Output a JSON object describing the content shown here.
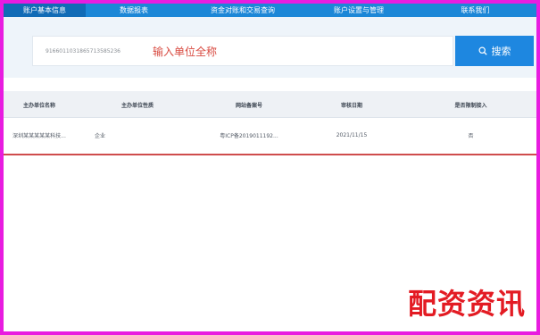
{
  "nav": {
    "tabs": [
      {
        "label": "账户基本信息",
        "active": true
      },
      {
        "label": "数据报表",
        "active": false
      },
      {
        "label": "资金对账和交易查询",
        "active": false
      },
      {
        "label": "账户设置与管理",
        "active": false
      },
      {
        "label": "联系我们",
        "active": false
      }
    ]
  },
  "search": {
    "value": "9166011031865713585236",
    "placeholder": "输入单位全称",
    "button_label": "搜索"
  },
  "table": {
    "columns": [
      "主办单位名称",
      "主办单位性质",
      "网站备案号",
      "审核日期",
      "是否限制接入"
    ],
    "rows": [
      [
        "深圳某某某某某科技...",
        "企业",
        "粤ICP备2019011192...",
        "2021/11/15",
        "否"
      ]
    ]
  },
  "watermark": "配资资讯",
  "colors": {
    "frame": "#e81ce0",
    "nav": "#1c87d7",
    "nav_active": "#116bb6",
    "button": "#1e87e0",
    "hint": "#d84a40",
    "row_border": "#cf4c4c",
    "watermark": "#e31b23"
  }
}
